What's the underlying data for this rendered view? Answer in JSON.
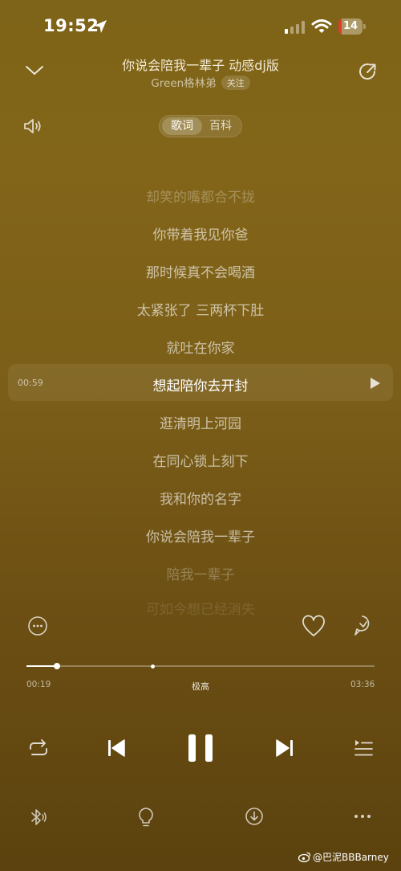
{
  "status_bar": {
    "time": "19:52",
    "battery": "14",
    "battery_level": 0.14,
    "battery_color": "#e0392f"
  },
  "header": {
    "song_title": "你说会陪我一辈子 动感dj版",
    "artist": "Green格林弟",
    "follow_label": "关注"
  },
  "tabs": {
    "lyrics": "歌词",
    "wiki": "百科"
  },
  "lyrics": {
    "current_time": "00:59",
    "lines": [
      {
        "text": "却笑的嘴都合不拢",
        "state": "faded"
      },
      {
        "text": "你带着我见你爸",
        "state": "normal"
      },
      {
        "text": "那时候真不会喝酒",
        "state": "normal"
      },
      {
        "text": "太紧张了 三两杯下肚",
        "state": "normal"
      },
      {
        "text": "就吐在你家",
        "state": "normal"
      },
      {
        "text": "想起陪你去开封",
        "state": "current"
      },
      {
        "text": "逛清明上河园",
        "state": "normal"
      },
      {
        "text": "在同心锁上刻下",
        "state": "normal"
      },
      {
        "text": "我和你的名字",
        "state": "normal"
      },
      {
        "text": "你说会陪我一辈子",
        "state": "normal"
      },
      {
        "text": "陪我一辈子",
        "state": "faded"
      },
      {
        "text": "可如今想已经消失",
        "state": "faded"
      }
    ]
  },
  "player": {
    "elapsed": "00:19",
    "total": "03:36",
    "quality": "极高",
    "progress": 0.088,
    "buffered": 0.364
  },
  "watermark": "@巴泥BBBarney",
  "icons": {
    "location": "location-arrow-icon",
    "signal": "cellular-signal-icon",
    "wifi": "wifi-icon",
    "collapse": "chevron-down-icon",
    "share": "share-icon",
    "volume": "volume-icon",
    "more_circle": "more-circle-icon",
    "like": "heart-icon",
    "comment": "comment-icon",
    "repeat": "repeat-icon",
    "prev": "previous-icon",
    "pause": "pause-icon",
    "next": "next-icon",
    "queue": "playlist-icon",
    "bluetooth": "bluetooth-icon",
    "light": "lightbulb-icon",
    "download": "download-icon",
    "more": "more-icon"
  }
}
